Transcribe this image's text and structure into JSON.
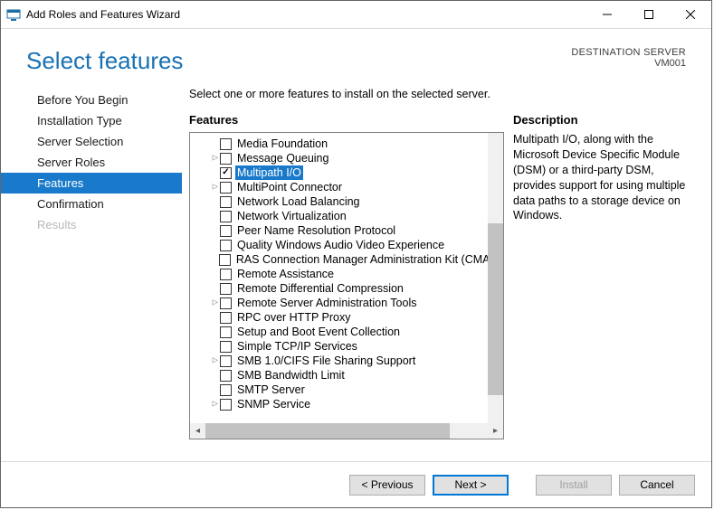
{
  "titlebar": {
    "title": "Add Roles and Features Wizard"
  },
  "header": {
    "page_title": "Select features",
    "dest_label": "DESTINATION SERVER",
    "dest_value": "VM001"
  },
  "sidebar": {
    "steps": [
      {
        "label": "Before You Begin",
        "state": "normal"
      },
      {
        "label": "Installation Type",
        "state": "normal"
      },
      {
        "label": "Server Selection",
        "state": "normal"
      },
      {
        "label": "Server Roles",
        "state": "normal"
      },
      {
        "label": "Features",
        "state": "active"
      },
      {
        "label": "Confirmation",
        "state": "normal"
      },
      {
        "label": "Results",
        "state": "disabled"
      }
    ]
  },
  "content": {
    "instruction": "Select one or more features to install on the selected server.",
    "features_heading": "Features",
    "description_heading": "Description",
    "description_text": "Multipath I/O, along with the Microsoft Device Specific Module (DSM) or a third-party DSM, provides support for using multiple data paths to a storage device on Windows.",
    "items": [
      {
        "label": "Media Foundation",
        "checked": false,
        "expandable": false,
        "selected": false
      },
      {
        "label": "Message Queuing",
        "checked": false,
        "expandable": true,
        "selected": false
      },
      {
        "label": "Multipath I/O",
        "checked": true,
        "expandable": false,
        "selected": true
      },
      {
        "label": "MultiPoint Connector",
        "checked": false,
        "expandable": true,
        "selected": false
      },
      {
        "label": "Network Load Balancing",
        "checked": false,
        "expandable": false,
        "selected": false
      },
      {
        "label": "Network Virtualization",
        "checked": false,
        "expandable": false,
        "selected": false
      },
      {
        "label": "Peer Name Resolution Protocol",
        "checked": false,
        "expandable": false,
        "selected": false
      },
      {
        "label": "Quality Windows Audio Video Experience",
        "checked": false,
        "expandable": false,
        "selected": false
      },
      {
        "label": "RAS Connection Manager Administration Kit (CMAK)",
        "checked": false,
        "expandable": false,
        "selected": false
      },
      {
        "label": "Remote Assistance",
        "checked": false,
        "expandable": false,
        "selected": false
      },
      {
        "label": "Remote Differential Compression",
        "checked": false,
        "expandable": false,
        "selected": false
      },
      {
        "label": "Remote Server Administration Tools",
        "checked": false,
        "expandable": true,
        "selected": false
      },
      {
        "label": "RPC over HTTP Proxy",
        "checked": false,
        "expandable": false,
        "selected": false
      },
      {
        "label": "Setup and Boot Event Collection",
        "checked": false,
        "expandable": false,
        "selected": false
      },
      {
        "label": "Simple TCP/IP Services",
        "checked": false,
        "expandable": false,
        "selected": false
      },
      {
        "label": "SMB 1.0/CIFS File Sharing Support",
        "checked": false,
        "expandable": true,
        "selected": false
      },
      {
        "label": "SMB Bandwidth Limit",
        "checked": false,
        "expandable": false,
        "selected": false
      },
      {
        "label": "SMTP Server",
        "checked": false,
        "expandable": false,
        "selected": false
      },
      {
        "label": "SNMP Service",
        "checked": false,
        "expandable": true,
        "selected": false
      }
    ]
  },
  "footer": {
    "previous": "< Previous",
    "next": "Next >",
    "install": "Install",
    "cancel": "Cancel"
  }
}
